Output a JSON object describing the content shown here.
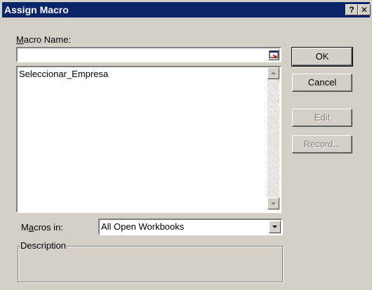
{
  "window": {
    "title": "Assign Macro",
    "help_glyph": "?",
    "close_glyph": "✕"
  },
  "macro_name": {
    "label": "Macro Name:",
    "value": "",
    "ref_icon": "collapse-dialog-icon"
  },
  "macro_list": {
    "items": [
      "Seleccionar_Empresa"
    ]
  },
  "buttons": {
    "ok": "OK",
    "cancel": "Cancel",
    "edit": "Edit",
    "record": "Record..."
  },
  "macros_in": {
    "label": "Macros in:",
    "value": "All Open Workbooks"
  },
  "description": {
    "label": "Description",
    "value": ""
  },
  "colors": {
    "title_bar": "#0a246a",
    "face": "#d4d0c8"
  }
}
